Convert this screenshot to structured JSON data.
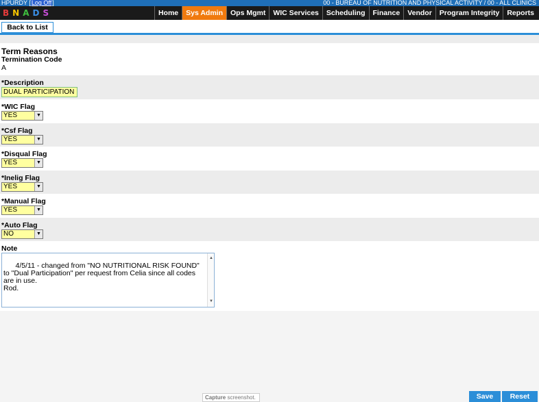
{
  "topbar": {
    "user": "HPURDY",
    "logoff": "Log Off",
    "location": "00 - BUREAU OF NUTRITION AND PHYSICAL ACTIVITY / 00 - ALL CLINICS"
  },
  "logo": {
    "letters": [
      "B",
      "N",
      "A",
      "D",
      "S"
    ],
    "colors": [
      "#e63b3b",
      "#f5c400",
      "#3fbf3f",
      "#3a8ee6",
      "#c84fd8"
    ]
  },
  "nav": {
    "items": [
      "Home",
      "Sys Admin",
      "Ops Mgmt",
      "WIC Services",
      "Scheduling",
      "Finance",
      "Vendor",
      "Program Integrity",
      "Reports"
    ],
    "active": "Sys Admin",
    "active_color": "#f07a0e"
  },
  "toolbar": {
    "back_label": "Back to List"
  },
  "form": {
    "title": "Term Reasons",
    "termination_code_label": "Termination Code",
    "termination_code_value": "A",
    "description_label": "*Description",
    "description_value": "DUAL PARTICIPATION",
    "wic_flag_label": "*WIC Flag",
    "wic_flag_value": "YES",
    "csf_flag_label": "*Csf Flag",
    "csf_flag_value": "YES",
    "disqual_flag_label": "*Disqual Flag",
    "disqual_flag_value": "YES",
    "inelig_flag_label": "*Inelig Flag",
    "inelig_flag_value": "YES",
    "manual_flag_label": "*Manual Flag",
    "manual_flag_value": "YES",
    "auto_flag_label": "*Auto Flag",
    "auto_flag_value": "NO",
    "note_label": "Note",
    "note_value": "4/5/11 - changed from \"NO NUTRITIONAL RISK FOUND\" to \"Dual Participation\" per request from Celia since all codes are in use.\nRod."
  },
  "capture": {
    "bold": "Capture",
    "rest": " screenshot."
  },
  "footer": {
    "save_label": "Save",
    "reset_label": "Reset"
  },
  "colors": {
    "accent": "#2b8ed8",
    "input_bg": "#ffffa0",
    "topbar": "#1f6fb8"
  }
}
